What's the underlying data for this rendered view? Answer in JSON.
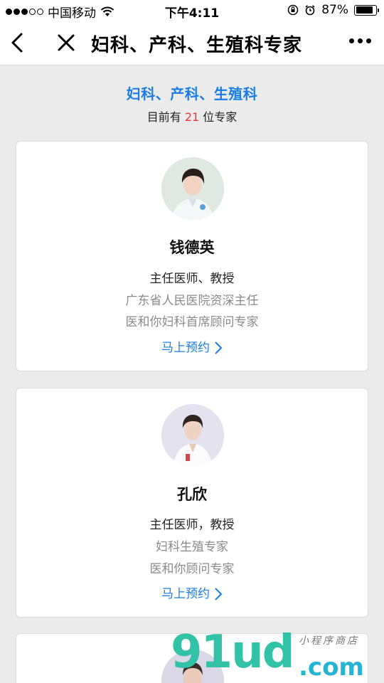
{
  "status_bar": {
    "carrier": "中国移动",
    "time": "下午4:11",
    "battery_percent": "87%",
    "battery_level": 0.87
  },
  "nav": {
    "title": "妇科、产科、生殖科专家"
  },
  "header": {
    "category_title": "妇科、产科、生殖科",
    "count_prefix": "目前有",
    "count": "21",
    "count_suffix": "位专家"
  },
  "experts": [
    {
      "name": "钱德英",
      "title": "主任医师、教授",
      "desc_lines": [
        "广东省人民医院资深主任",
        "医和你妇科首席顾问专家"
      ],
      "book_label": "马上预约"
    },
    {
      "name": "孔欣",
      "title": "主任医师，教授",
      "desc_lines": [
        "妇科生殖专家",
        "医和你顾问专家"
      ],
      "book_label": "马上预约"
    }
  ],
  "watermark": {
    "main": "91ud",
    "domain": ".com",
    "tagline": "小程序商店"
  },
  "colors": {
    "accent": "#1a7de6",
    "count_highlight": "#e33333",
    "background": "#ebebeb",
    "muted_text": "#8a8a8a"
  }
}
